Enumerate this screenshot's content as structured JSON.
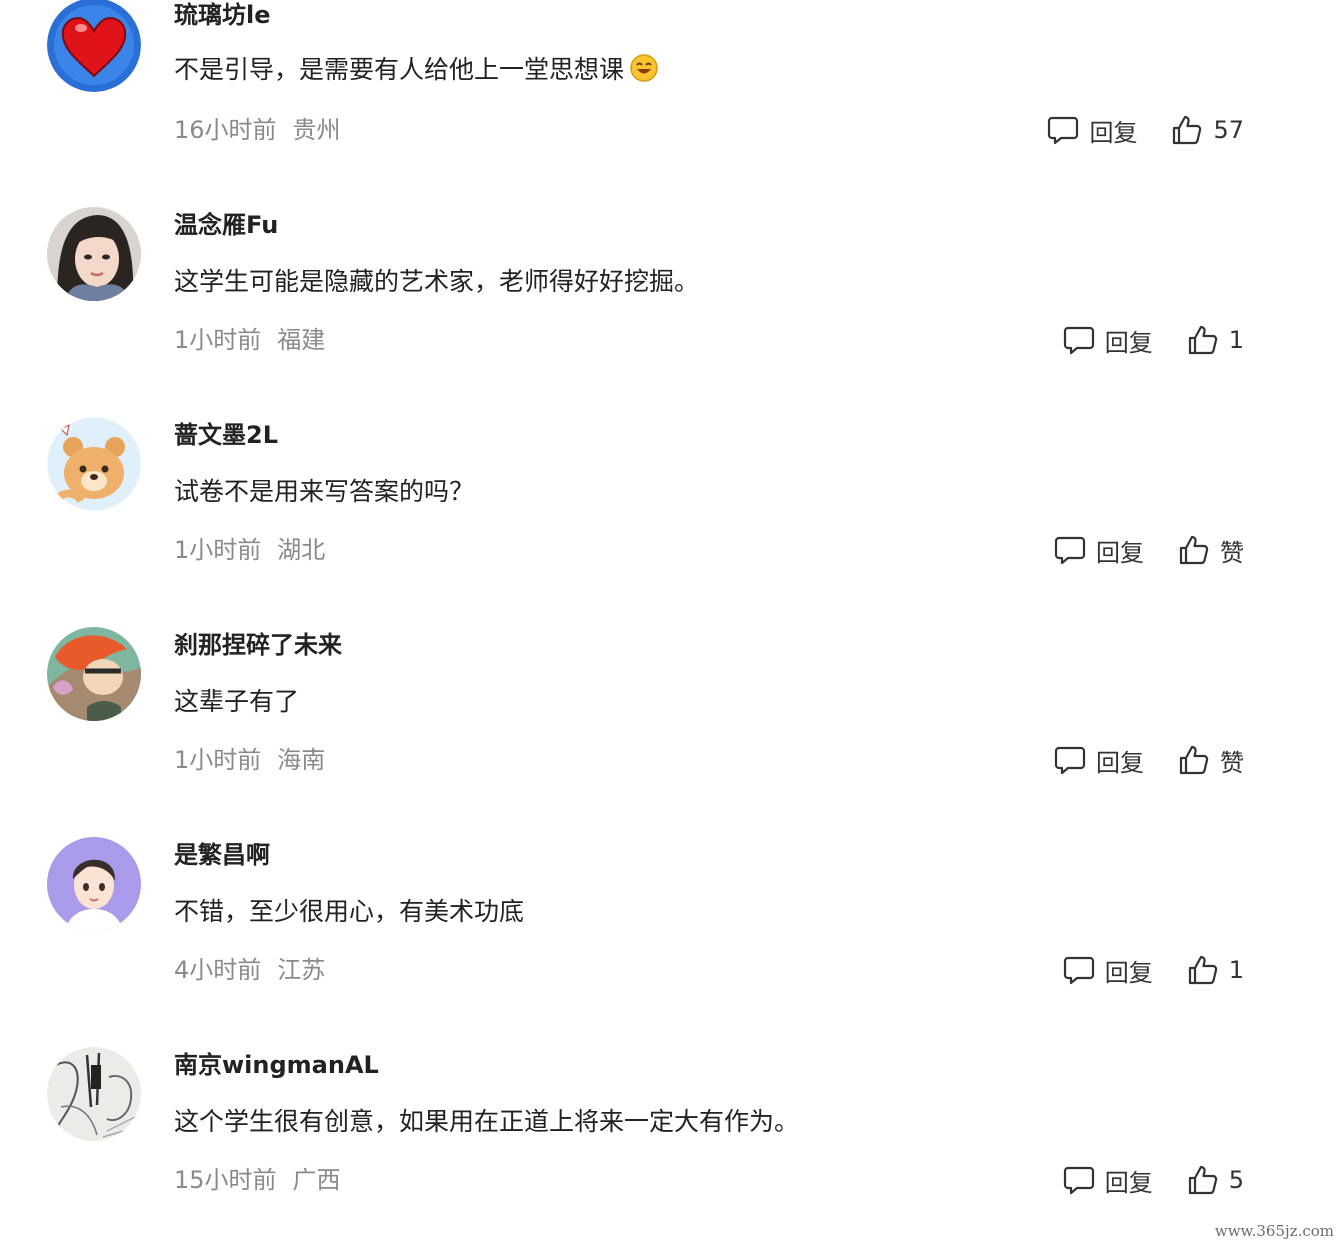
{
  "comments": [
    {
      "username": "琉璃坊le",
      "content": "不是引导，是需要有人给他上一堂思想课",
      "has_emoji": true,
      "emoji": "smiley-emoji-icon",
      "time": "16小时前",
      "location": "贵州",
      "reply_label": "回复",
      "like_label": "57",
      "avatar": "red-heart-avatar"
    },
    {
      "username": "温念雁Fu",
      "content": "这学生可能是隐藏的艺术家，老师得好好挖掘。",
      "time": "1小时前",
      "location": "福建",
      "reply_label": "回复",
      "like_label": "1",
      "avatar": "woman-photo-avatar"
    },
    {
      "username": "蔷文墨2L",
      "content": "试卷不是用来写答案的吗？",
      "time": "1小时前",
      "location": "湖北",
      "reply_label": "回复",
      "like_label": "赞",
      "avatar": "cartoon-bear-avatar"
    },
    {
      "username": "刹那捏碎了未来",
      "content": "这辈子有了",
      "time": "1小时前",
      "location": "海南",
      "reply_label": "回复",
      "like_label": "赞",
      "avatar": "anime-character-avatar"
    },
    {
      "username": "是繁昌啊",
      "content": "不错，至少很用心，有美术功底",
      "time": "4小时前",
      "location": "江苏",
      "reply_label": "回复",
      "like_label": "1",
      "avatar": "cartoon-boy-avatar"
    },
    {
      "username": "南京wingmanAL",
      "content": "这个学生很有创意，如果用在正道上将来一定大有作为。",
      "time": "15小时前",
      "location": "广西",
      "reply_label": "回复",
      "like_label": "5",
      "avatar": "manga-sketch-avatar"
    }
  ],
  "watermark": "www.365jz.com",
  "colors": {
    "meta": "#8a8a8a",
    "text": "#222222",
    "heart": "#e0121a",
    "avatar_blue": "#2a6fd6"
  }
}
